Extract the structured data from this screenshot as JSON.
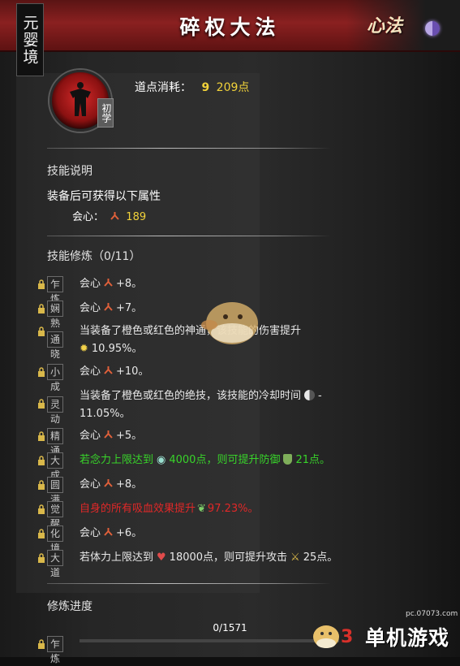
{
  "header": {
    "title": "碎权大法",
    "realm": "元婴境",
    "xinfa_label": "心法"
  },
  "skill": {
    "rank": "初学",
    "cost_label": "道点消耗：",
    "cost_value": "209点"
  },
  "description": {
    "section": "技能说明",
    "title": "装备后可获得以下属性",
    "attr_label": "会心：",
    "attr_value": "189"
  },
  "training": {
    "section": "技能修炼（0/11）",
    "levels": [
      {
        "tag": "乍炼",
        "text": "会心",
        "value": "+8。"
      },
      {
        "tag": "娴熟",
        "text": "会心",
        "value": "+7。"
      },
      {
        "tag": "通晓",
        "text": "当装备了橙色或红色的神通，该技能的伤害提升",
        "text2": "10.95%。"
      },
      {
        "tag": "小成",
        "text": "会心",
        "value": "+10。"
      },
      {
        "tag": "灵动",
        "text": "当装备了橙色或红色的绝技，该技能的冷却时间",
        "dash": "-",
        "text2": "11.05%。"
      },
      {
        "tag": "精通",
        "text": "会心",
        "value": "+5。"
      },
      {
        "tag": "大成",
        "text": "若念力上限达到",
        "mid": "4000点，则可提升防御",
        "end": "21点。"
      },
      {
        "tag": "圆满",
        "text": "会心",
        "value": "+8。"
      },
      {
        "tag": "觉醒",
        "text": "自身的所有吸血效果提升",
        "end": "97.23%。"
      },
      {
        "tag": "化境",
        "text": "会心",
        "value": "+6。"
      },
      {
        "tag": "大道",
        "text": "若体力上限达到",
        "mid": "18000点，则可提升攻击",
        "end": "25点。"
      }
    ]
  },
  "progress": {
    "section": "修炼进度",
    "tag": "乍炼",
    "text": "0/1571",
    "current": 0,
    "max": 1571
  },
  "watermark": {
    "site": "pc.07073.com",
    "brand": "单机游戏",
    "num": "3"
  },
  "colors": {
    "accent_red": "#8a2020",
    "gold": "#f1d23a",
    "green": "#38d42a",
    "red": "#e02828"
  }
}
